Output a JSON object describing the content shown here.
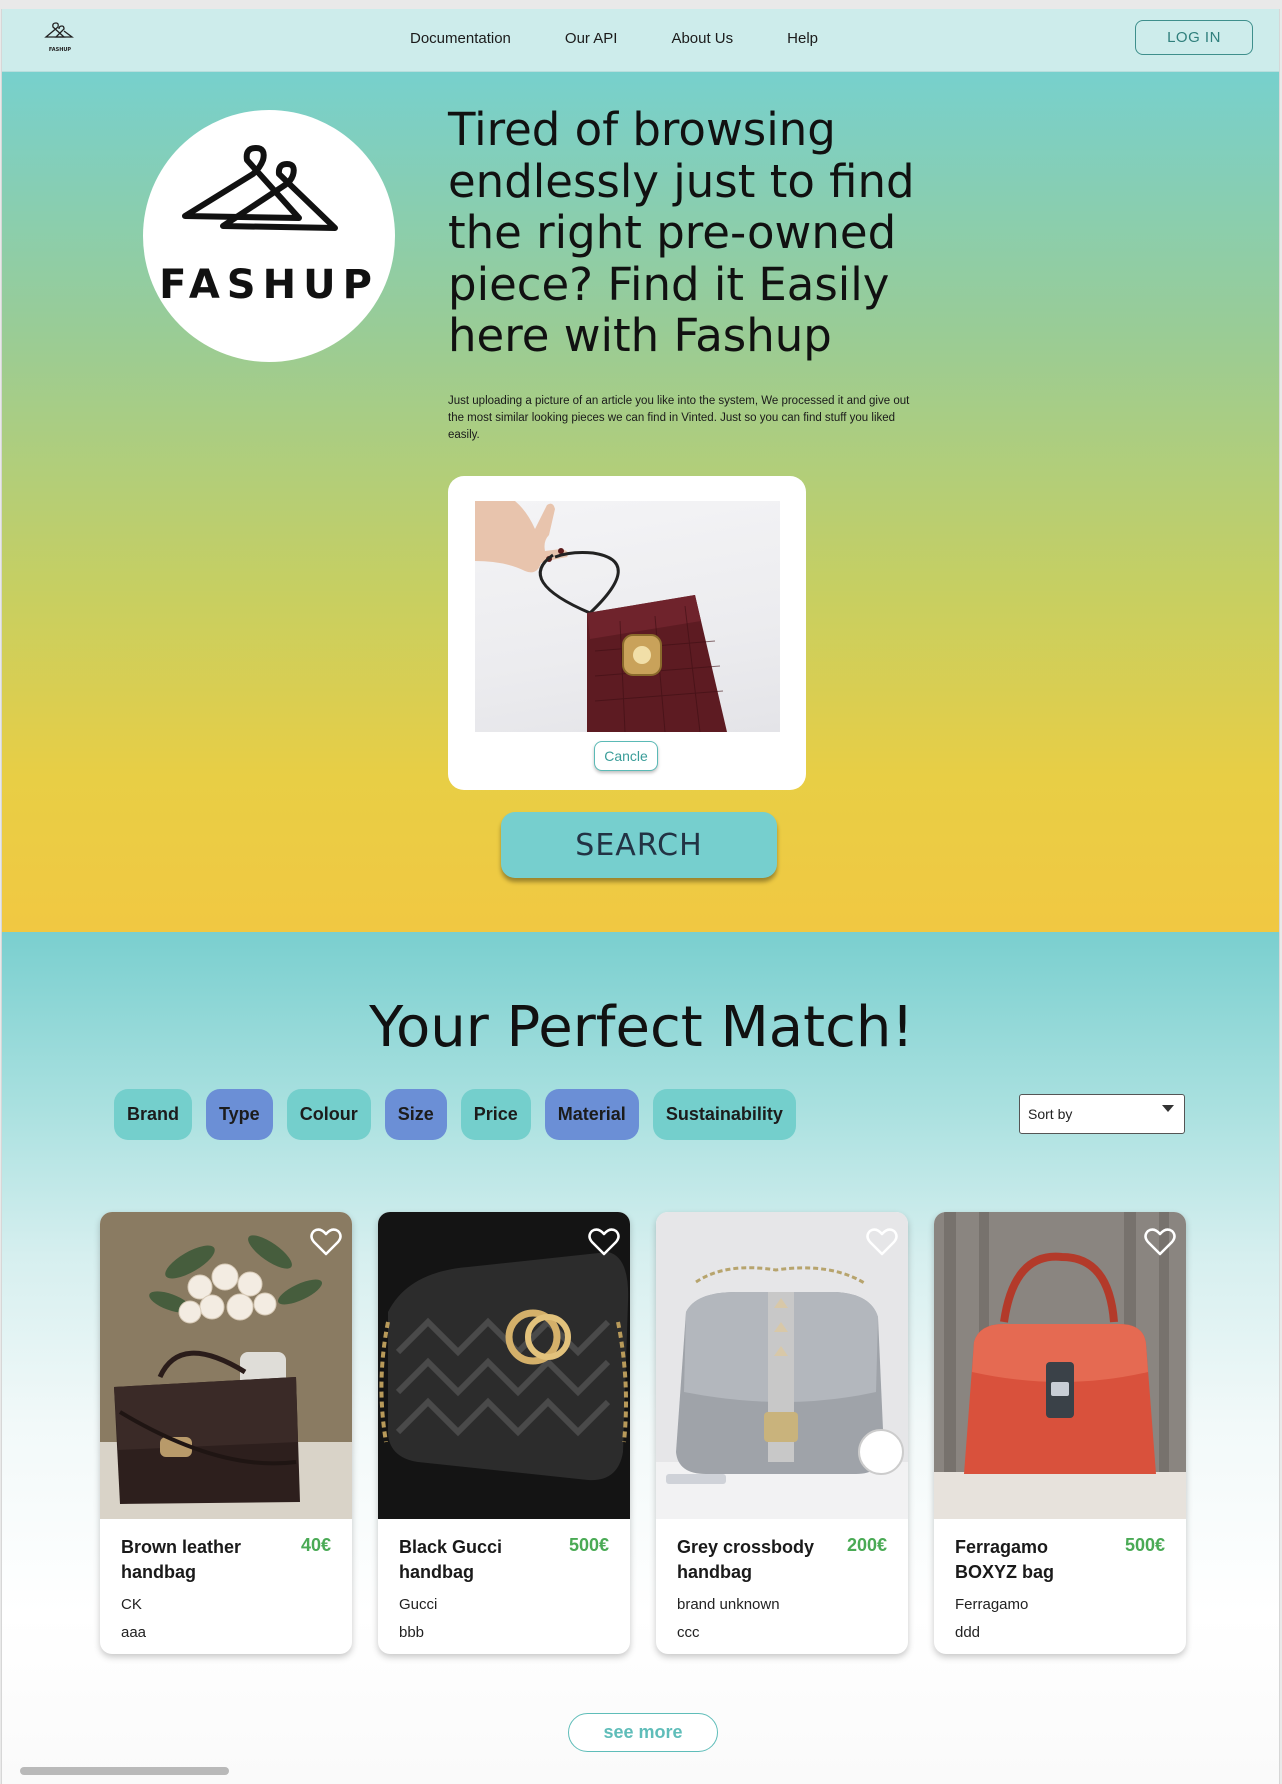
{
  "nav": {
    "logo_text": "FASHUP",
    "links": [
      "Documentation",
      "Our API",
      "About Us",
      "Help"
    ],
    "login_label": "LOG IN"
  },
  "hero": {
    "logo_word": "FASHUP",
    "title": "Tired of browsing endlessly just to find the right pre-owned piece? Find it Easily here with Fashup",
    "subtitle": "Just uploading a picture of an article you like into the system, We processed it and give out the most similar looking pieces we can find in Vinted. Just so you can find stuff you liked easily.",
    "cancel_label": "Cancle",
    "search_label": "SEARCH"
  },
  "results": {
    "title": "Your Perfect Match!",
    "filters": [
      {
        "label": "Brand",
        "color": "#74cfcc"
      },
      {
        "label": "Type",
        "color": "#6b8fd6"
      },
      {
        "label": "Colour",
        "color": "#74cfcc"
      },
      {
        "label": "Size",
        "color": "#6b8fd6"
      },
      {
        "label": "Price",
        "color": "#74cfcc"
      },
      {
        "label": "Material",
        "color": "#6b8fd6"
      },
      {
        "label": "Sustainability",
        "color": "#74cfcc"
      }
    ],
    "sort_label": "Sort by",
    "products": [
      {
        "name": "Brown leather handbag",
        "price": "40€",
        "brand": "CK",
        "note": "aaa",
        "image": "brown-bag-with-roses"
      },
      {
        "name": "Black Gucci handbag",
        "price": "500€",
        "brand": "Gucci",
        "note": "bbb",
        "image": "black-gucci-bag"
      },
      {
        "name": "Grey crossbody handbag",
        "price": "200€",
        "brand": "brand unknown",
        "note": "ccc",
        "image": "grey-crossbody-bag"
      },
      {
        "name": "Ferragamo BOXYZ bag",
        "price": "500€",
        "brand": "Ferragamo",
        "note": "ddd",
        "image": "red-ferragamo-bag"
      }
    ],
    "see_more_label": "see more"
  },
  "colors": {
    "accent_teal": "#76cfce",
    "accent_blue": "#6b8fd6",
    "price_green": "#4aaa55",
    "hero_top": "#77d0cd",
    "hero_bottom": "#f1c842"
  }
}
